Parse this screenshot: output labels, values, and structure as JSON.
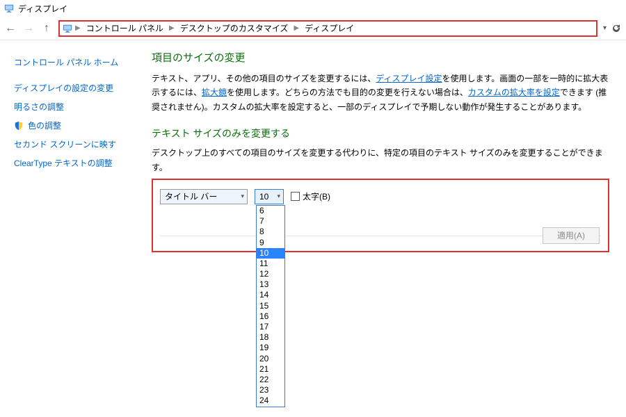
{
  "window": {
    "title": "ディスプレイ"
  },
  "breadcrumb": {
    "items": [
      "コントロール パネル",
      "デスクトップのカスタマイズ",
      "ディスプレイ"
    ]
  },
  "sidebar": {
    "items": [
      {
        "label": "コントロール パネル ホーム",
        "shield": false
      },
      {
        "label": "ディスプレイの設定の変更",
        "shield": false
      },
      {
        "label": "明るさの調整",
        "shield": false
      },
      {
        "label": "色の調整",
        "shield": true
      },
      {
        "label": "セカンド スクリーンに映す",
        "shield": false
      },
      {
        "label": "ClearType テキストの調整",
        "shield": false
      }
    ]
  },
  "main": {
    "h1": "項目のサイズの変更",
    "para_pre": "テキスト、アプリ、その他の項目のサイズを変更するには、",
    "link1": "ディスプレイ設定",
    "para_mid1": "を使用します。画面の一部を一時的に拡大表示するには、",
    "link2": "拡大鏡",
    "para_mid2": "を使用します。どちらの方法でも目的の変更を行えない場合は、",
    "link3": "カスタムの拡大率を設定",
    "para_post": "できます (推奨されません)。カスタムの拡大率を設定すると、一部のディスプレイで予期しない動作が発生することがあります。",
    "h2": "テキスト サイズのみを変更する",
    "sub": "デスクトップ上のすべての項目のサイズを変更する代わりに、特定の項目のテキスト サイズのみを変更することができます。",
    "item_combo": {
      "selected": "タイトル バー"
    },
    "size_combo": {
      "selected": "10",
      "options": [
        "6",
        "7",
        "8",
        "9",
        "10",
        "11",
        "12",
        "13",
        "14",
        "15",
        "16",
        "17",
        "18",
        "19",
        "20",
        "21",
        "22",
        "23",
        "24"
      ]
    },
    "bold_label": "太字(B)",
    "apply_label": "適用(A)"
  }
}
